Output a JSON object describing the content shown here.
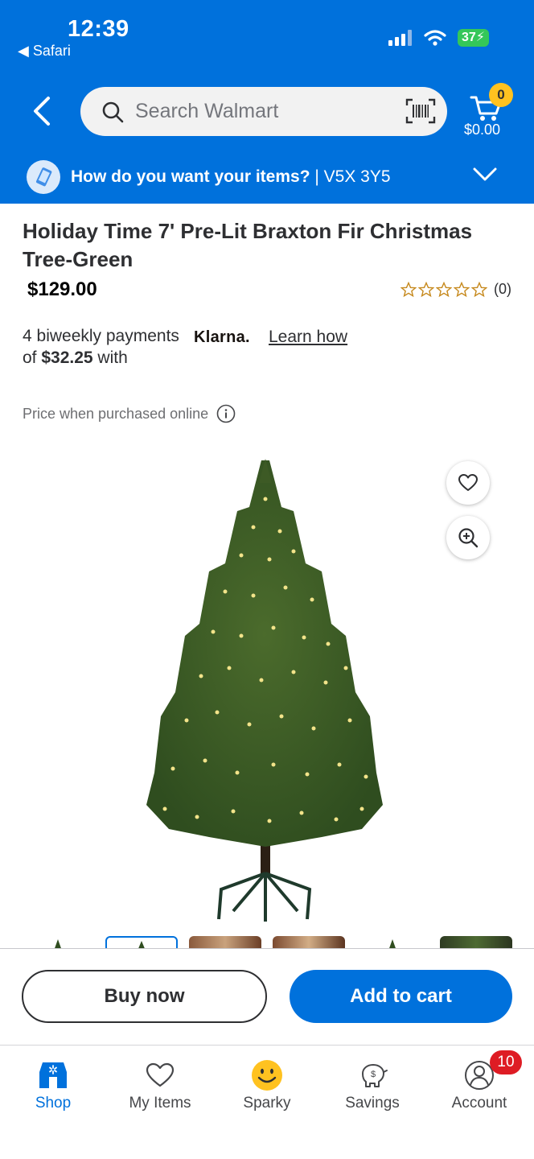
{
  "status_bar": {
    "time": "12:39",
    "back_app": "Safari",
    "battery": "37"
  },
  "header": {
    "search_placeholder": "Search Walmart",
    "cart_count": "0",
    "cart_total": "$0.00",
    "delivery_question": "How do you want your items?",
    "delivery_location": " | V5X 3Y5"
  },
  "product": {
    "title": "Holiday Time 7' Pre-Lit Braxton Fir Christmas Tree-Green",
    "price": "$129.00",
    "rating_stars": 0,
    "rating_count": "(0)",
    "klarna_line1": "4 biweekly payments of ",
    "klarna_amount": "$32.25",
    "klarna_line2": " with",
    "klarna_brand": "Klarna.",
    "learn_how": "Learn how",
    "price_note": "Price when purchased online"
  },
  "actions": {
    "buy_now": "Buy now",
    "add_to_cart": "Add to cart"
  },
  "nav": {
    "shop": "Shop",
    "my_items": "My Items",
    "sparky": "Sparky",
    "savings": "Savings",
    "account": "Account",
    "account_badge": "10"
  },
  "colors": {
    "brand_blue": "#0071dc",
    "spark_yellow": "#ffc220",
    "badge_red": "#de1c24"
  }
}
